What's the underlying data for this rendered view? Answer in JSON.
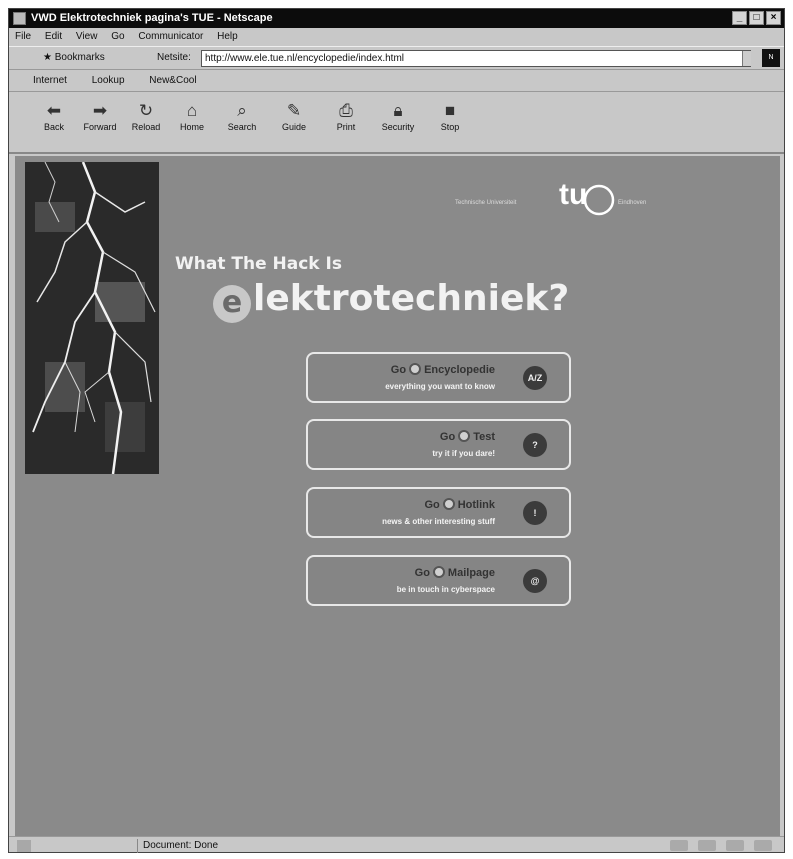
{
  "window": {
    "title": "VWD Elektrotechniek pagina's TUE - Netscape"
  },
  "menu": [
    "File",
    "Edit",
    "View",
    "Go",
    "Communicator",
    "Help"
  ],
  "location": {
    "bookmarks_label": "Bookmarks",
    "netsite_label": "Netsite:",
    "url": "http://www.ele.tue.nl/encyclopedie/index.html"
  },
  "personal_toolbar": [
    "Internet",
    "Lookup",
    "New&Cool"
  ],
  "nav_buttons": [
    {
      "label": "Back",
      "icon": "back-arrow-icon"
    },
    {
      "label": "Forward",
      "icon": "forward-arrow-icon"
    },
    {
      "label": "Reload",
      "icon": "reload-icon"
    },
    {
      "label": "Home",
      "icon": "home-icon"
    },
    {
      "label": "Search",
      "icon": "search-icon"
    },
    {
      "label": "Guide",
      "icon": "guide-icon"
    },
    {
      "label": "Print",
      "icon": "print-icon"
    },
    {
      "label": "Security",
      "icon": "security-lock-icon"
    },
    {
      "label": "Stop",
      "icon": "stop-icon"
    }
  ],
  "page": {
    "tue_logo": {
      "text": "tu",
      "left_text": "Technische Universiteit",
      "right_text": "Eindhoven"
    },
    "heading": "What The Hack Is",
    "big_title_e": "e",
    "big_title_rest": "lektrotechniek?",
    "links": [
      {
        "go": "Go",
        "target": "Encyclopedie",
        "sub": "everything you want to know",
        "badge": "A/Z"
      },
      {
        "go": "Go",
        "target": "Test",
        "sub": "try it if you dare!",
        "badge": "?"
      },
      {
        "go": "Go",
        "target": "Hotlink",
        "sub": "news & other interesting stuff",
        "badge": "!"
      },
      {
        "go": "Go",
        "target": "Mailpage",
        "sub": "be in touch in cyberspace",
        "badge": "@"
      }
    ]
  },
  "status": {
    "text": "Document: Done"
  },
  "colors": {
    "page_bg": "#8a8a8a",
    "chrome": "#c8c8c8",
    "titlebar": "#0c0c0c"
  }
}
